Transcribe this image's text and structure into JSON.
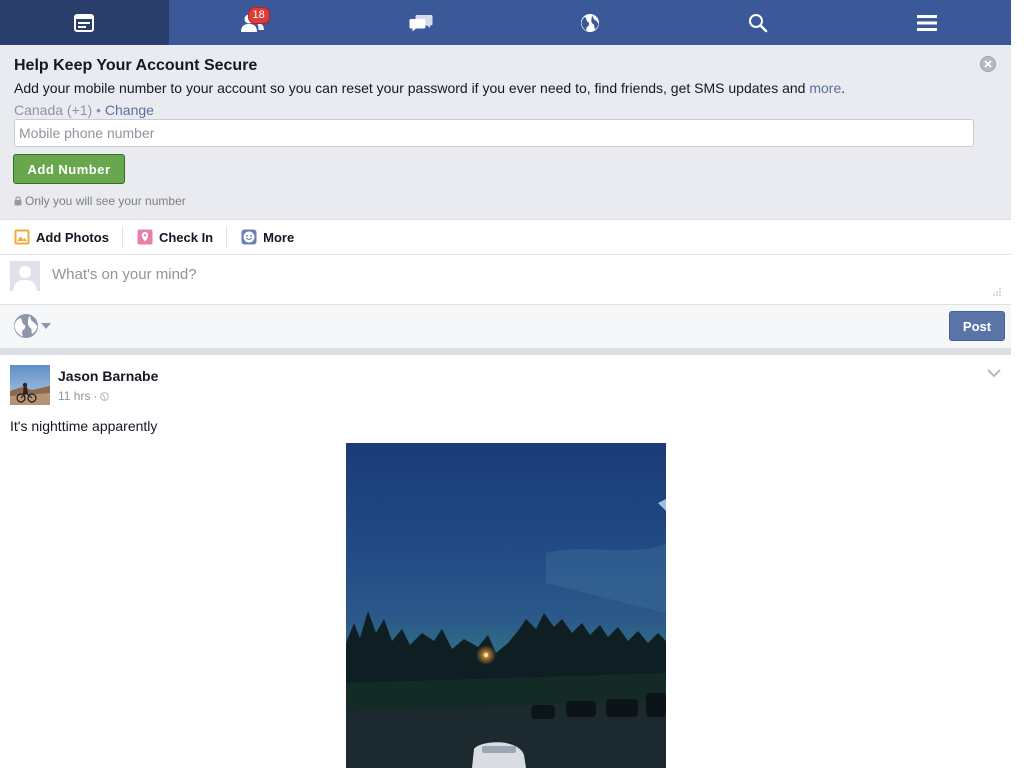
{
  "nav": {
    "items": [
      {
        "icon": "news-feed-icon",
        "active": true
      },
      {
        "icon": "friend-requests-icon",
        "badge": "18"
      },
      {
        "icon": "messages-icon"
      },
      {
        "icon": "notifications-globe-icon"
      },
      {
        "icon": "search-icon"
      },
      {
        "icon": "menu-icon"
      }
    ],
    "color": "#3b5998"
  },
  "security": {
    "title": "Help Keep Your Account Secure",
    "description": "Add your mobile number to your account so you can reset your password if you ever need to, find friends, get SMS updates and ",
    "more_link": "more",
    "description_end": ".",
    "country": "Canada (+1)",
    "separator": " • ",
    "change_link": "Change",
    "phone_placeholder": "Mobile phone number",
    "add_button": "Add Number",
    "privacy_note": "Only you will see your number"
  },
  "composer": {
    "actions": [
      {
        "label": "Add Photos",
        "icon": "photo-icon"
      },
      {
        "label": "Check In",
        "icon": "location-pin-icon"
      },
      {
        "label": "More",
        "icon": "smiley-icon"
      }
    ],
    "status_placeholder": "What's on your mind?",
    "post_button": "Post",
    "audience_icon": "globe-icon"
  },
  "post": {
    "author": "Jason Barnabe",
    "time": "11 hrs",
    "dot": "·",
    "audience_icon": "public-globe-icon",
    "text": "It's nighttime apparently",
    "photo_alt": "Night sky over trees and a parking lot"
  }
}
